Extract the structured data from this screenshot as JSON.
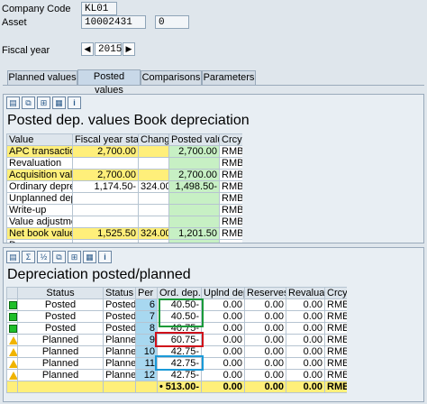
{
  "header": {
    "company_code_label": "Company Code",
    "company_code_value": "KL01",
    "asset_label": "Asset",
    "asset_value": "10002431",
    "asset_sub_value": "0",
    "fiscal_year_label": "Fiscal year",
    "fiscal_year_value": "2015",
    "prev_icon": "triangle-left-icon",
    "next_icon": "triangle-right-icon"
  },
  "tabs": [
    {
      "label": "Planned values",
      "active": false
    },
    {
      "label": "Posted values",
      "active": true
    },
    {
      "label": "Comparisons",
      "active": false
    },
    {
      "label": "Parameters",
      "active": false
    }
  ],
  "posted": {
    "title": "Posted dep. values Book depreciation",
    "columns": [
      "Value",
      "Fiscal year start",
      "Change",
      "Posted values",
      "Crcy"
    ],
    "rows": [
      {
        "value": "APC transactions",
        "fy_start": "2,700.00",
        "change": "",
        "posted": "2,700.00",
        "crcy": "RMB",
        "style": "yel"
      },
      {
        "value": "Revaluation",
        "fy_start": "",
        "change": "",
        "posted": "",
        "crcy": "RMB",
        "style": ""
      },
      {
        "value": "Acquisition value",
        "fy_start": "2,700.00",
        "change": "",
        "posted": "2,700.00",
        "crcy": "RMB",
        "style": "yel"
      },
      {
        "value": "Ordinary deprec.",
        "fy_start": "1,174.50-",
        "change": "324.00-",
        "posted": "1,498.50-",
        "crcy": "RMB",
        "style": ""
      },
      {
        "value": "Unplanned dep.",
        "fy_start": "",
        "change": "",
        "posted": "",
        "crcy": "RMB",
        "style": ""
      },
      {
        "value": "Write-up",
        "fy_start": "",
        "change": "",
        "posted": "",
        "crcy": "RMB",
        "style": ""
      },
      {
        "value": "Value adjustment",
        "fy_start": "",
        "change": "",
        "posted": "",
        "crcy": "RMB",
        "style": ""
      },
      {
        "value": "Net book value",
        "fy_start": "1,525.50",
        "change": "324.00-",
        "posted": "1,201.50",
        "crcy": "RMB",
        "style": "yel"
      },
      {
        "value": "Down payments",
        "fy_start": "",
        "change": "",
        "posted": "",
        "crcy": "",
        "style": ""
      }
    ]
  },
  "planned": {
    "title": "Depreciation posted/planned",
    "columns": [
      "Status",
      "Status",
      "Per",
      "Ord. dep.",
      "Uplnd dep.",
      "Reserves",
      "Revaluat.",
      "Crcy"
    ],
    "rows": [
      {
        "icon": "green-square-icon",
        "status1": "Posted",
        "status2": "Posted",
        "per": "6",
        "ord": "40.50-",
        "upl": "0.00",
        "res": "0.00",
        "rev": "0.00",
        "crcy": "RMB"
      },
      {
        "icon": "green-square-icon",
        "status1": "Posted",
        "status2": "Posted",
        "per": "7",
        "ord": "40.50-",
        "upl": "0.00",
        "res": "0.00",
        "rev": "0.00",
        "crcy": "RMB"
      },
      {
        "icon": "green-square-icon",
        "status1": "Posted",
        "status2": "Posted",
        "per": "8",
        "ord": "40.75-",
        "upl": "0.00",
        "res": "0.00",
        "rev": "0.00",
        "crcy": "RMB"
      },
      {
        "icon": "warning-triangle-icon",
        "status1": "Planned",
        "status2": "Planned",
        "per": "9",
        "ord": "60.75-",
        "upl": "0.00",
        "res": "0.00",
        "rev": "0.00",
        "crcy": "RMB"
      },
      {
        "icon": "warning-triangle-icon",
        "status1": "Planned",
        "status2": "Planned",
        "per": "10",
        "ord": "42.75-",
        "upl": "0.00",
        "res": "0.00",
        "rev": "0.00",
        "crcy": "RMB"
      },
      {
        "icon": "warning-triangle-icon",
        "status1": "Planned",
        "status2": "Planned",
        "per": "11",
        "ord": "42.75-",
        "upl": "0.00",
        "res": "0.00",
        "rev": "0.00",
        "crcy": "RMB"
      },
      {
        "icon": "warning-triangle-icon",
        "status1": "Planned",
        "status2": "Planned",
        "per": "12",
        "ord": "42.75-",
        "upl": "0.00",
        "res": "0.00",
        "rev": "0.00",
        "crcy": "RMB"
      }
    ],
    "total": {
      "marker": "•",
      "ord": "513.00-",
      "upl": "0.00",
      "res": "0.00",
      "rev": "0.00",
      "crcy": "RMB"
    }
  },
  "highlight_colors": {
    "green": "#1a9a3a",
    "red": "#d0101a",
    "blue": "#1a9ad8"
  }
}
